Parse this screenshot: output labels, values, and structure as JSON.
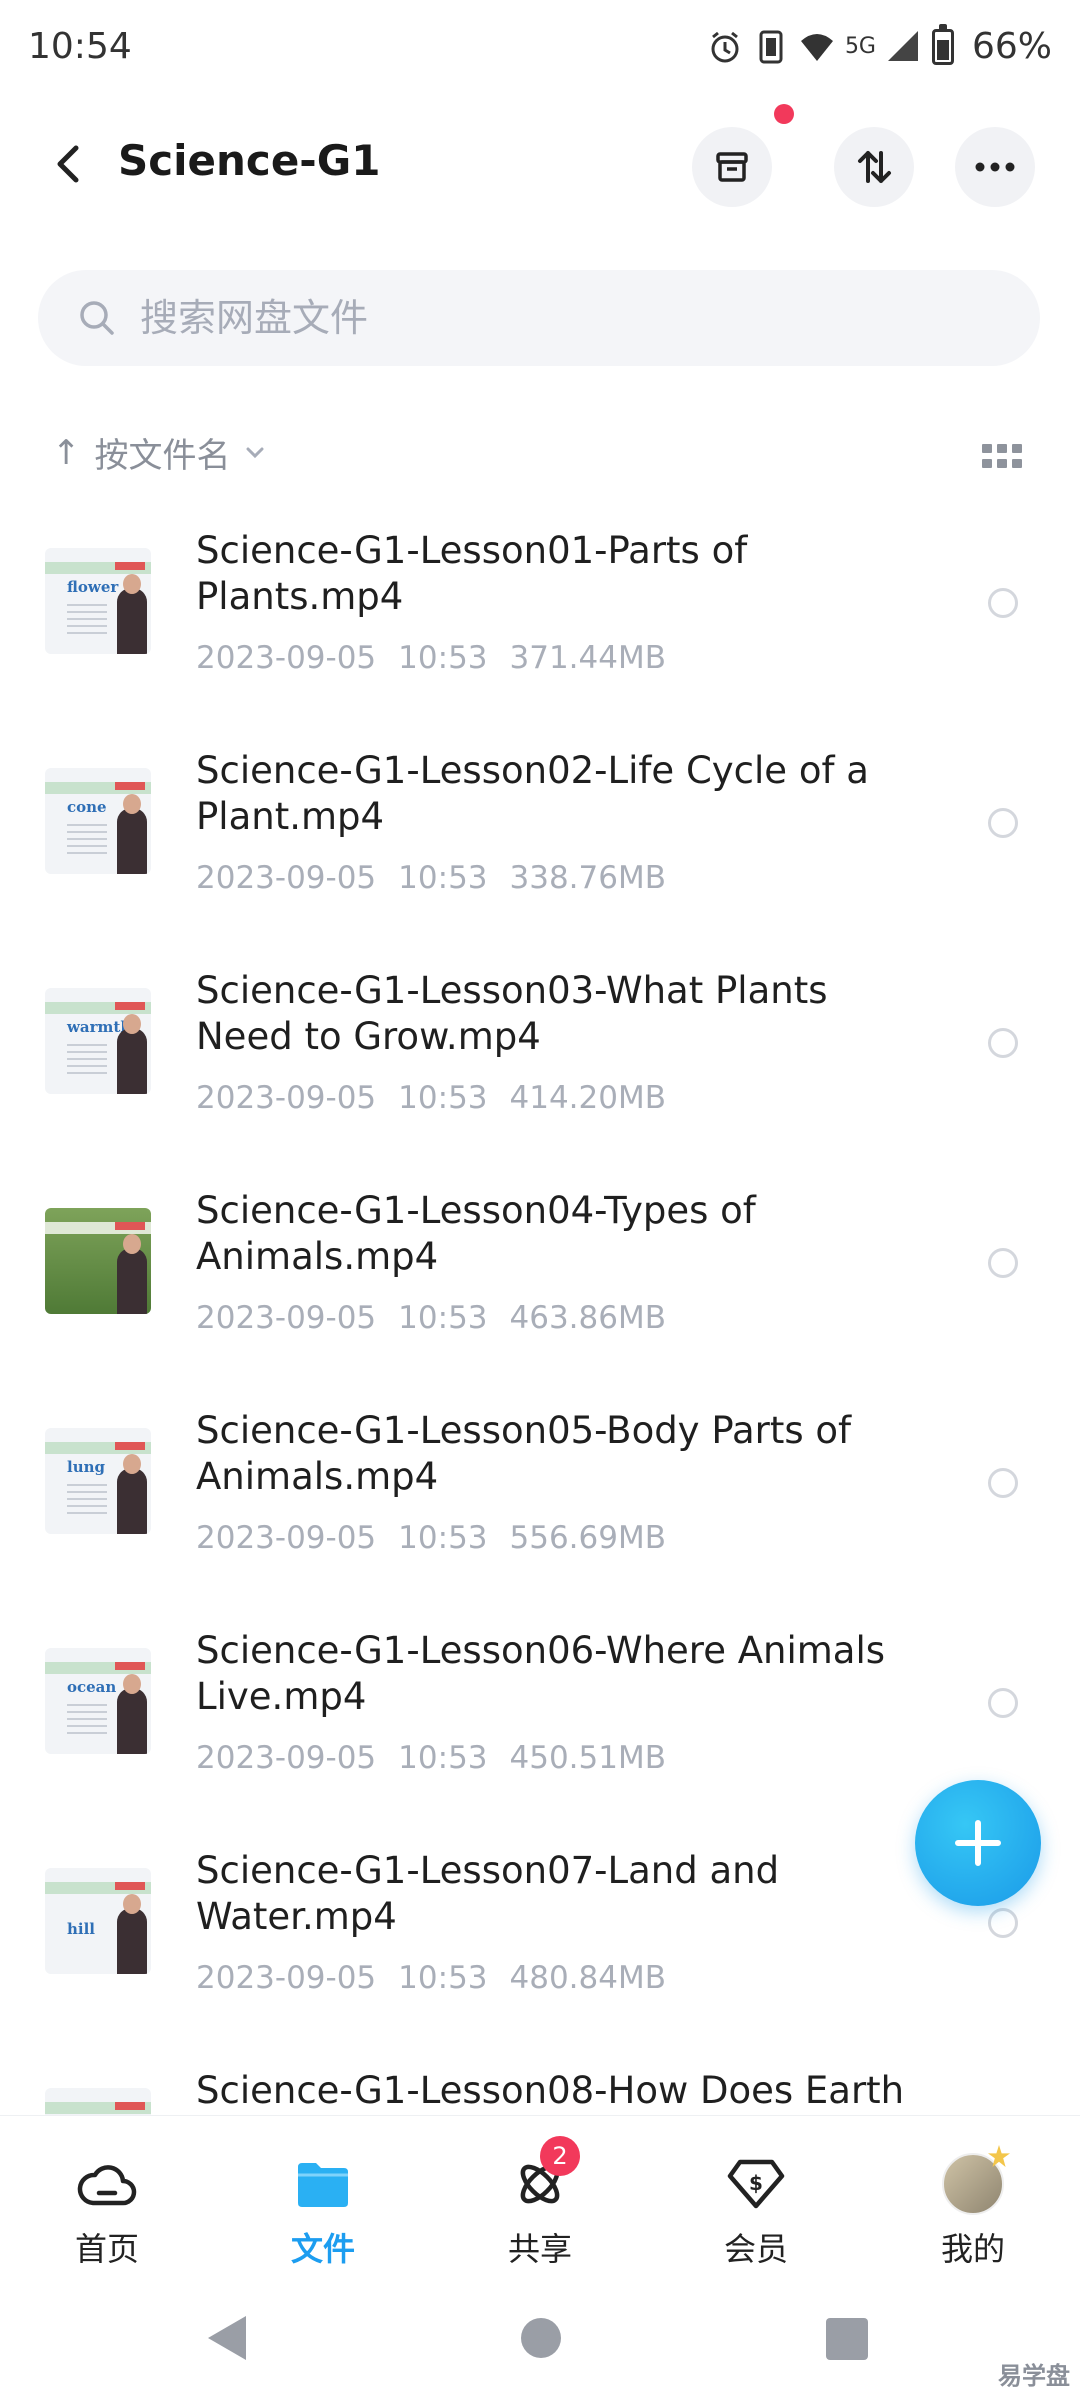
{
  "status_bar": {
    "time": "10:54",
    "network": "5G",
    "battery": "66%"
  },
  "header": {
    "title": "Science-G1"
  },
  "search": {
    "placeholder": "搜索网盘文件"
  },
  "sort": {
    "arrow": "↑",
    "label": "按文件名"
  },
  "files": [
    {
      "name": "Science-G1-Lesson01-Parts of Plants.mp4",
      "date": "2023-09-05",
      "time": "10:53",
      "size": "371.44MB",
      "thumb_word": "flower"
    },
    {
      "name": "Science-G1-Lesson02-Life Cycle of a Plant.mp4",
      "date": "2023-09-05",
      "time": "10:53",
      "size": "338.76MB",
      "thumb_word": "cone"
    },
    {
      "name": "Science-G1-Lesson03-What Plants Need to Grow.mp4",
      "date": "2023-09-05",
      "time": "10:53",
      "size": "414.20MB",
      "thumb_word": "warmth"
    },
    {
      "name": "Science-G1-Lesson04-Types of Animals.mp4",
      "date": "2023-09-05",
      "time": "10:53",
      "size": "463.86MB",
      "thumb_word": ""
    },
    {
      "name": "Science-G1-Lesson05-Body Parts of Animals.mp4",
      "date": "2023-09-05",
      "time": "10:53",
      "size": "556.69MB",
      "thumb_word": "lung"
    },
    {
      "name": "Science-G1-Lesson06-Where Animals Live.mp4",
      "date": "2023-09-05",
      "time": "10:53",
      "size": "450.51MB",
      "thumb_word": "ocean"
    },
    {
      "name": "Science-G1-Lesson07-Land and Water.mp4",
      "date": "2023-09-05",
      "time": "10:53",
      "size": "480.84MB",
      "thumb_word": "hill"
    },
    {
      "name": "Science-G1-Lesson08-How Does Earth",
      "date": "",
      "time": "",
      "size": "",
      "thumb_word": ""
    }
  ],
  "bottom_nav": {
    "home": "首页",
    "files": "文件",
    "share": "共享",
    "share_badge": "2",
    "vip": "会员",
    "me": "我的"
  },
  "watermark": "易学盘",
  "colors": {
    "accent": "#1c9df0",
    "badge": "#f2395b",
    "meta_text": "#a9aeb8"
  }
}
